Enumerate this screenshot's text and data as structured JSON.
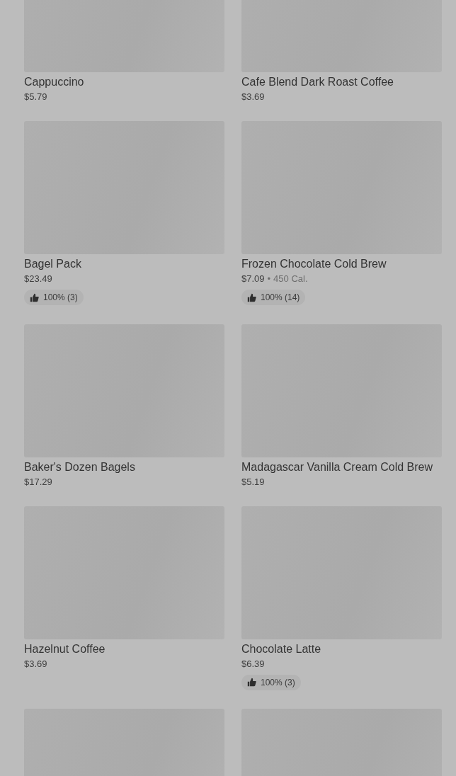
{
  "items": [
    {
      "kind": "product",
      "name": "Cappuccino",
      "price": "$5.79"
    },
    {
      "kind": "product",
      "name": "Cafe Blend Dark Roast Coffee",
      "price": "$3.69"
    },
    {
      "kind": "product",
      "name": "Bagel Pack",
      "price": "$23.49",
      "rating": "100% (3)"
    },
    {
      "kind": "product",
      "name": "Frozen Chocolate Cold Brew",
      "price": "$7.09",
      "separator": "•",
      "calories": "450 Cal.",
      "rating": "100% (14)"
    },
    {
      "kind": "product",
      "name": "Baker's Dozen Bagels",
      "price": "$17.29"
    },
    {
      "kind": "product",
      "name": "Madagascar Vanilla Cream Cold Brew",
      "price": "$5.19"
    },
    {
      "kind": "product",
      "name": "Hazelnut Coffee",
      "price": "$3.69"
    },
    {
      "kind": "product",
      "name": "Chocolate Latte",
      "price": "$6.39",
      "rating": "100% (3)"
    },
    {
      "kind": "image_only"
    },
    {
      "kind": "image_only"
    }
  ]
}
